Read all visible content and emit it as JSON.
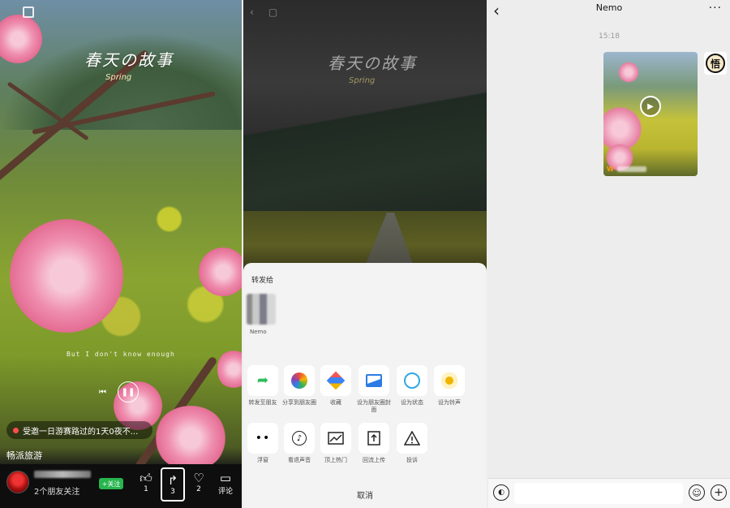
{
  "feed": {
    "title_art": "春天の故事",
    "title_art_sub": "Spring",
    "lyric": "But I don't know enough",
    "notice": "受邀一日游赛路过的1天0夜不...",
    "channel": "畅派旅游",
    "followers": "2个朋友关注",
    "follow_label": "+关注",
    "like_count": "1",
    "share_count": "3",
    "fav_count": "2",
    "comment_label": "评论"
  },
  "share_sheet": {
    "title": "转发给",
    "contact_name": "Nemo",
    "options_row1": [
      {
        "icon": "forward-arrow",
        "color": "#2dbd5a",
        "label": "转发至朋友"
      },
      {
        "icon": "moments-pinwheel",
        "color": "#e94b3c",
        "label": "分享到朋友圈"
      },
      {
        "icon": "favorites-cube",
        "color": "#3b82f6",
        "label": "收藏"
      },
      {
        "icon": "image-cover",
        "color": "#2b7be4",
        "label": "设为朋友圈封面"
      },
      {
        "icon": "status-ring",
        "color": "#2fa8e6",
        "label": "设为状态"
      },
      {
        "icon": "ringtone",
        "color": "#f0b400",
        "label": "设为铃声"
      }
    ],
    "options_row2": [
      {
        "icon": "more-dots",
        "label": "浮窗"
      },
      {
        "icon": "listen-audio",
        "label": "看退声音"
      },
      {
        "icon": "trend-chart",
        "label": "顶上热门"
      },
      {
        "icon": "upload-box",
        "label": "回流上传"
      },
      {
        "icon": "warning-triangle",
        "label": "投诉"
      }
    ],
    "cancel_label": "取消"
  },
  "chat": {
    "contact_name": "Nemo",
    "time": "15:18",
    "avatar_char": "悟",
    "video_source_logo": "W"
  }
}
